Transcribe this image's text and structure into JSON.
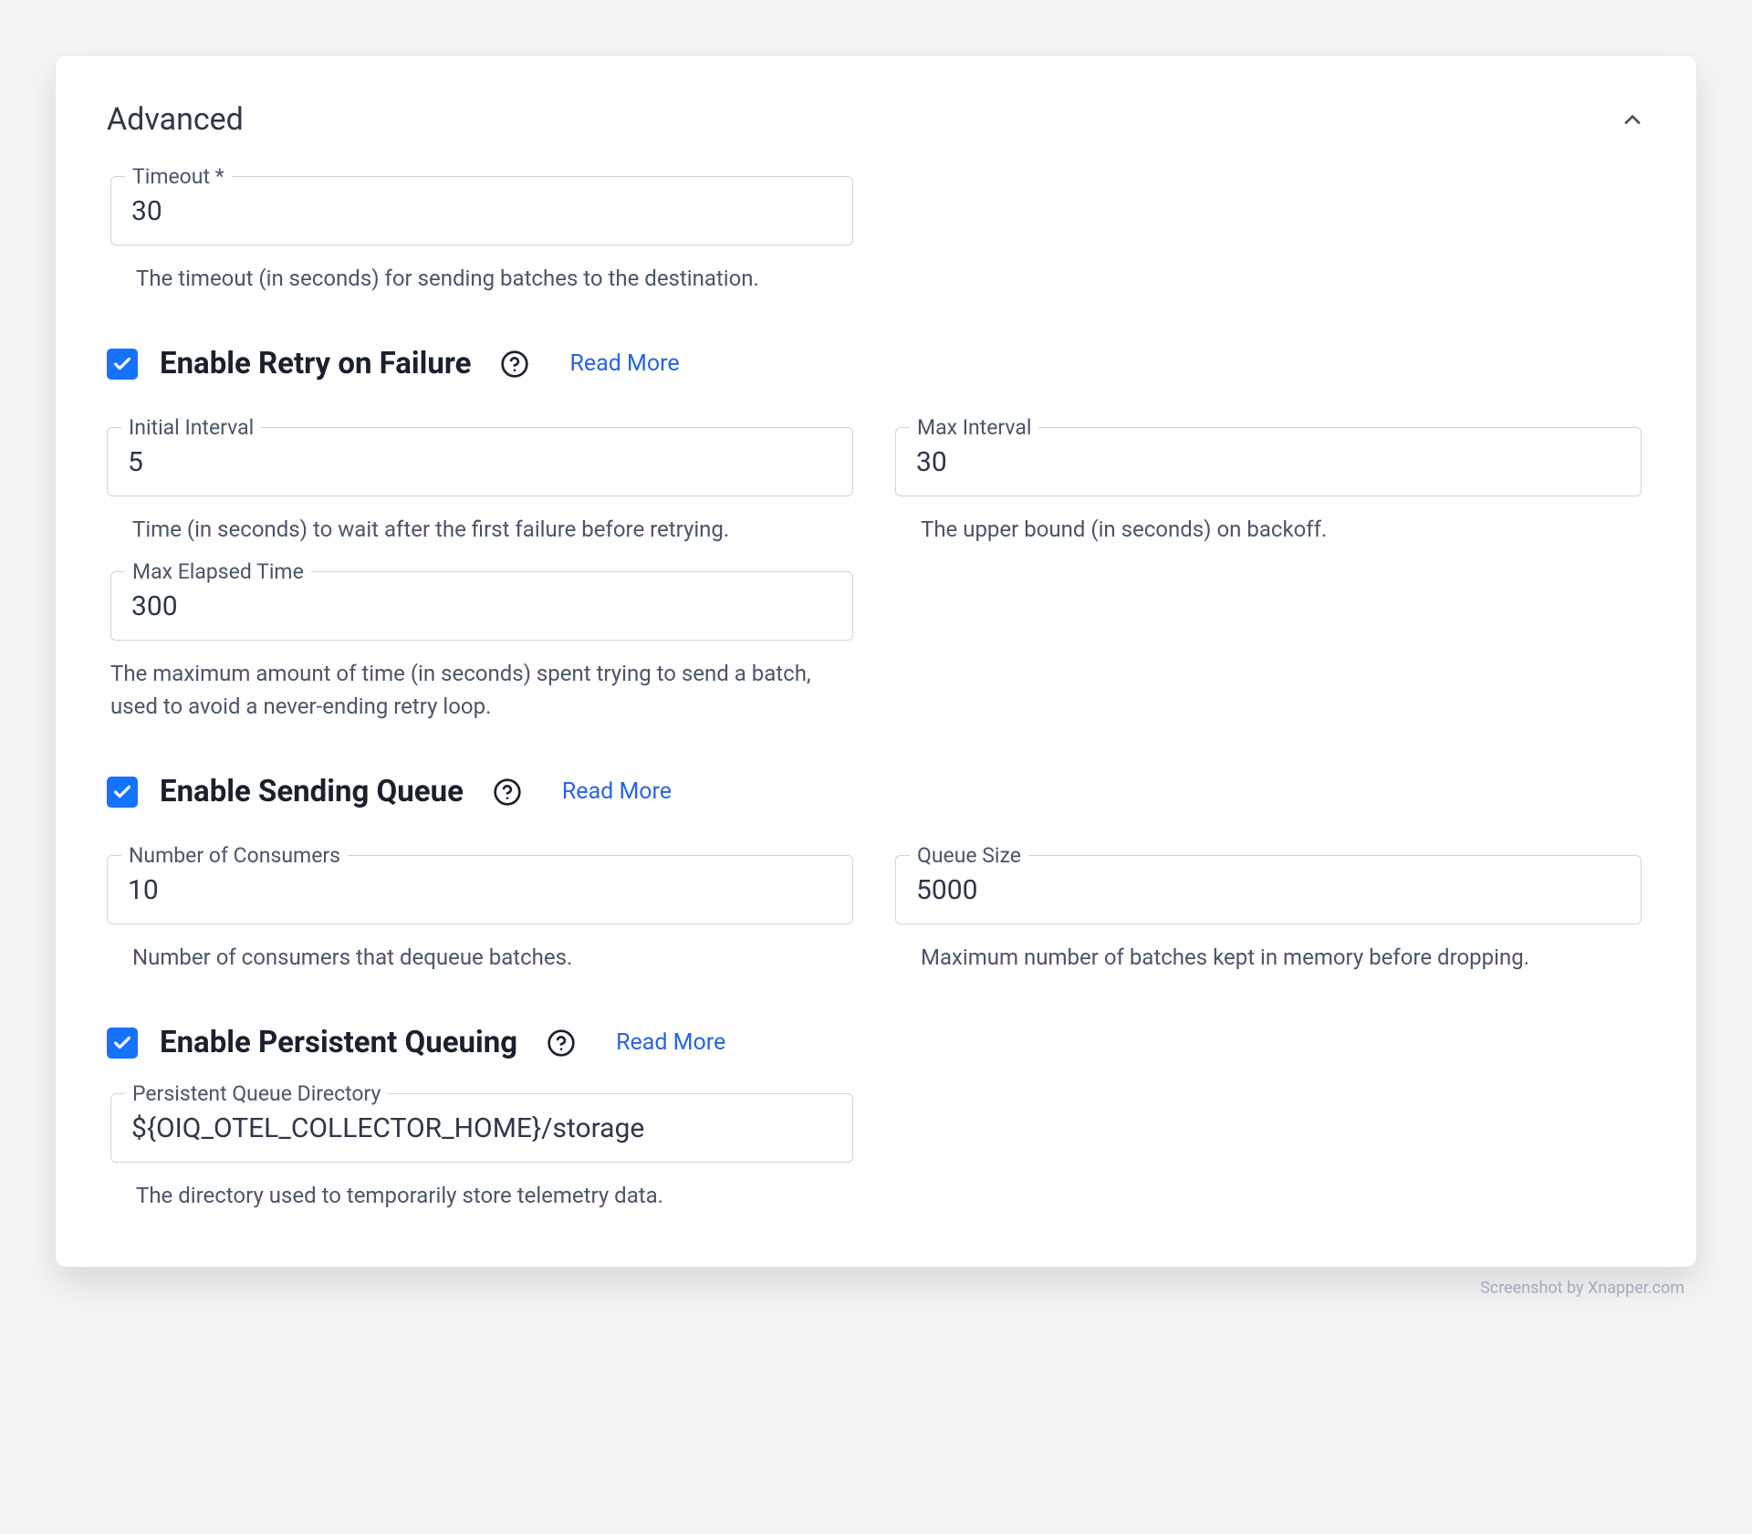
{
  "section": {
    "title": "Advanced"
  },
  "timeout": {
    "label": "Timeout *",
    "value": "30",
    "helper": "The timeout (in seconds) for sending batches to the destination."
  },
  "retry": {
    "title": "Enable Retry on Failure",
    "readmore": "Read More",
    "initial_interval": {
      "label": "Initial Interval",
      "value": "5",
      "helper": "Time (in seconds) to wait after the first failure before retrying."
    },
    "max_interval": {
      "label": "Max Interval",
      "value": "30",
      "helper": "The upper bound (in seconds) on backoff."
    },
    "max_elapsed": {
      "label": "Max Elapsed Time",
      "value": "300",
      "helper": "The maximum amount of time (in seconds) spent trying to send a batch, used to avoid a never-ending retry loop."
    }
  },
  "queue": {
    "title": "Enable Sending Queue",
    "readmore": "Read More",
    "consumers": {
      "label": "Number of Consumers",
      "value": "10",
      "helper": "Number of consumers that dequeue batches."
    },
    "size": {
      "label": "Queue Size",
      "value": "5000",
      "helper": "Maximum number of batches kept in memory before dropping."
    }
  },
  "persist": {
    "title": "Enable Persistent Queuing",
    "readmore": "Read More",
    "directory": {
      "label": "Persistent Queue Directory",
      "value": "${OIQ_OTEL_COLLECTOR_HOME}/storage",
      "helper": "The directory used to temporarily store telemetry data."
    }
  },
  "attribution": "Screenshot by Xnapper.com"
}
